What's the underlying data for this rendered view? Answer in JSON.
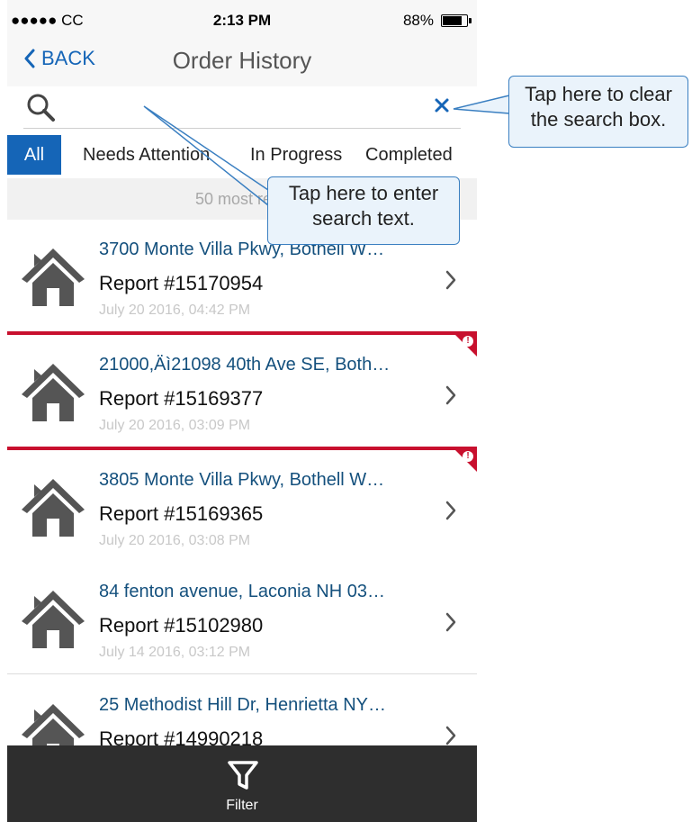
{
  "status_bar": {
    "carrier": "●●●●● CC",
    "time": "2:13 PM",
    "battery": "88%",
    "battery_level": 0.88
  },
  "nav": {
    "back_label": "BACK",
    "title": "Order History"
  },
  "search": {
    "placeholder": "",
    "value": ""
  },
  "tabs": [
    {
      "label": "All",
      "active": true
    },
    {
      "label": "Needs Attention",
      "active": false
    },
    {
      "label": "In Progress",
      "active": false
    },
    {
      "label": "Completed",
      "active": false
    }
  ],
  "banner": "50 most rece",
  "orders": [
    {
      "address": "3700 Monte Villa Pkwy, Bothell W…",
      "report": "Report #15170954",
      "date": "July 20 2016, 04:42 PM",
      "needs_attention": false
    },
    {
      "address": "21000,Äì21098 40th Ave SE, Both…",
      "report": "Report #15169377",
      "date": "July 20 2016, 03:09 PM",
      "needs_attention": true
    },
    {
      "address": "3805 Monte Villa Pkwy, Bothell W…",
      "report": "Report #15169365",
      "date": "July 20 2016, 03:08 PM",
      "needs_attention": true
    },
    {
      "address": "84 fenton avenue, Laconia NH 03…",
      "report": "Report #15102980",
      "date": "July 14 2016, 03:12 PM",
      "needs_attention": false
    },
    {
      "address": "25 Methodist Hill Dr, Henrietta NY…",
      "report": "Report #14990218",
      "date": "",
      "needs_attention": false
    }
  ],
  "filter": {
    "label": "Filter"
  },
  "callouts": {
    "clear": "Tap here to clear the search box.",
    "clear_line1": "Tap here to clear",
    "clear_line2": "the search box.",
    "enter_line1": "Tap here to enter",
    "enter_line2": "search text."
  },
  "colors": {
    "accent": "#1565b7",
    "attention": "#c8102e",
    "address": "#14507d",
    "filter_bar": "#2e2e2e"
  }
}
